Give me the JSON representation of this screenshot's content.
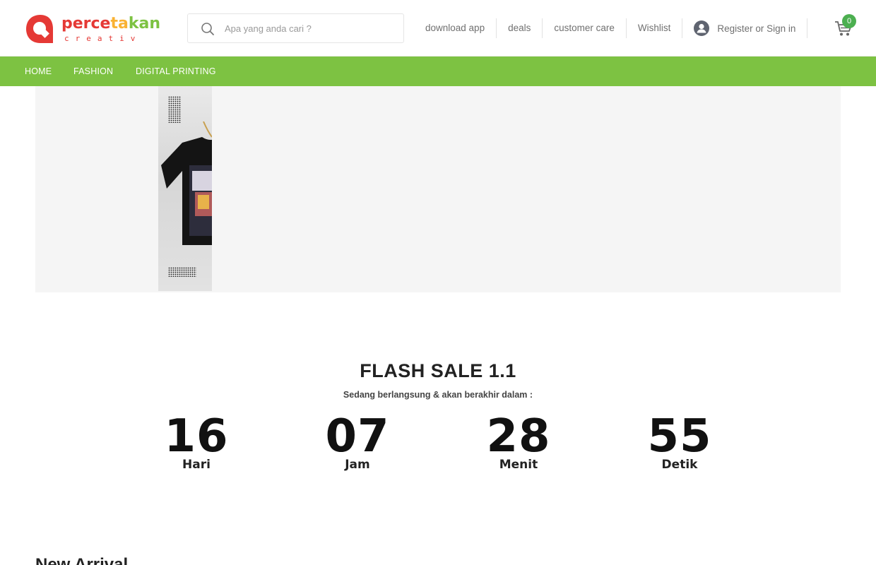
{
  "brand": {
    "logo_word": "percetakan",
    "logo_sub": "creativ",
    "colors": {
      "red": "#e53935",
      "green": "#7dc242",
      "yellow": "#f9b233",
      "orange": "#ef6c00"
    }
  },
  "search": {
    "placeholder": "Apa yang anda cari ?",
    "icon": "search-icon"
  },
  "top_links": [
    "download app",
    "deals",
    "customer care",
    "Wishlist"
  ],
  "account": {
    "label": "Register or Sign in",
    "icon": "user-icon"
  },
  "cart": {
    "count": "0",
    "icon": "cart-icon"
  },
  "nav": {
    "items": [
      "HOME",
      "FASHION",
      "DIGITAL PRINTING"
    ],
    "bg_color": "#7dc242"
  },
  "flash_sale": {
    "title": "FLASH SALE 1.1",
    "subtitle": "Sedang berlangsung & akan berakhir dalam :",
    "countdown": [
      {
        "value": "16",
        "label": "Hari"
      },
      {
        "value": "07",
        "label": "Jam"
      },
      {
        "value": "28",
        "label": "Menit"
      },
      {
        "value": "55",
        "label": "Detik"
      }
    ]
  },
  "sections": {
    "new_arrival_title": "New Arrival"
  }
}
